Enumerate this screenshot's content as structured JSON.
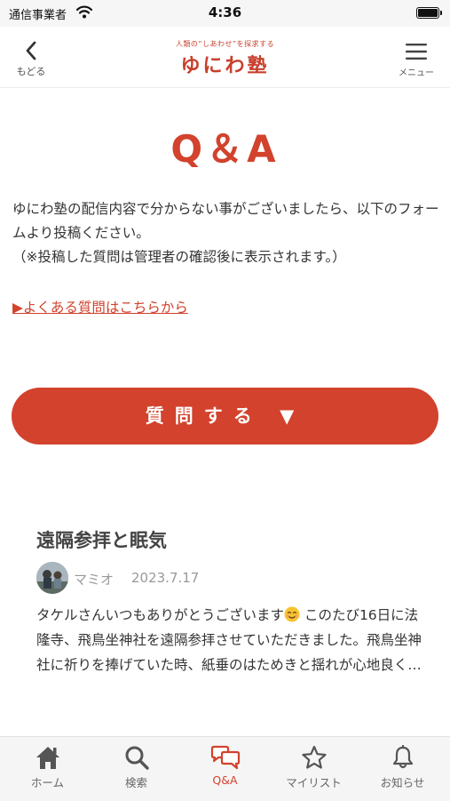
{
  "status_bar": {
    "carrier": "通信事業者",
    "time": "4:36"
  },
  "header": {
    "back_label": "もどる",
    "logo_tagline": "人類の“しあわせ”を探求する",
    "logo_name": "ゆにわ塾",
    "menu_label": "メニュー"
  },
  "page": {
    "title": "Q＆A",
    "intro_line1": "ゆにわ塾の配信内容で分からない事がございましたら、以下のフォームより投稿ください。",
    "intro_line2": "（※投稿した質問は管理者の確認後に表示されます。）",
    "faq_link": "▶よくある質問はこちらから",
    "ask_button": "質問する ▼"
  },
  "post": {
    "title": "遠隔参拝と眠気",
    "author": "マミオ",
    "date": "2023.7.17",
    "body_before_emoji": "タケルさんいつもありがとうございます",
    "body_after_emoji": " このたび16日に法隆寺、飛鳥坐神社を遠隔参拝させていただきました。飛鳥坐神社に祈りを捧げていた時、紙垂のはためきと揺れが心地良く…"
  },
  "tabbar": {
    "items": [
      {
        "label": "ホーム",
        "icon": "home-icon",
        "active": false
      },
      {
        "label": "検索",
        "icon": "search-icon",
        "active": false
      },
      {
        "label": "Q&A",
        "icon": "chat-bubbles-icon",
        "active": true
      },
      {
        "label": "マイリスト",
        "icon": "star-icon",
        "active": false
      },
      {
        "label": "お知らせ",
        "icon": "bell-icon",
        "active": false
      }
    ]
  },
  "colors": {
    "accent": "#d2422c",
    "tab_inactive": "#666666",
    "tab_bar_bg": "#f5f5f5"
  }
}
